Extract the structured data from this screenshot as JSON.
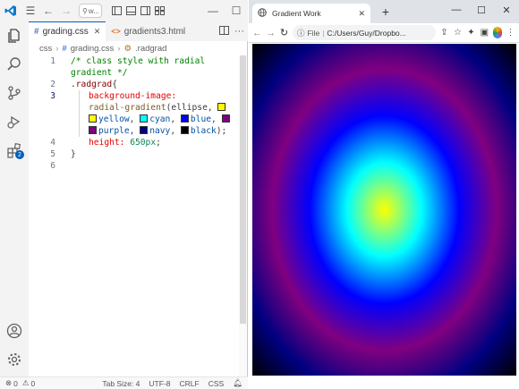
{
  "vscode": {
    "search_text": "w...",
    "tabs": [
      {
        "name": "grading.css",
        "active": true
      },
      {
        "name": "gradients3.html",
        "active": false
      }
    ],
    "breadcrumb": {
      "folder": "css",
      "file": "grading.css",
      "symbol": ".radgrad"
    },
    "line_numbers": [
      "1",
      "",
      "2",
      "3",
      "",
      "",
      "",
      "4",
      "5",
      "6"
    ],
    "code": {
      "line1a": "/* class style with radial",
      "line1b": "gradient */",
      "line2_selector": ".radgrad",
      "line2_brace": "{",
      "line3_prop": "background-image:",
      "line3_fn": "radial-gradient",
      "line3_args": "(ellipse, ",
      "line3_yellow": "yellow",
      "line3_cyan": "cyan",
      "line3_blue": "blue",
      "line3_purple": "purple",
      "line3_navy": "navy",
      "line3_black": "black",
      "line3_end": ");",
      "line4_prop": "height:",
      "line4_value": "650px",
      "line4_end": ";",
      "line5": "}",
      "comma": ", "
    },
    "swatch_colors": {
      "yellow": "#ffff00",
      "cyan": "#00ffff",
      "blue": "#0000ff",
      "purple": "#800080",
      "navy": "#000080",
      "black": "#000000"
    },
    "accounts_badge": "2",
    "status": {
      "errors": "0",
      "warnings": "0",
      "tab_size": "Tab Size: 4",
      "encoding": "UTF-8",
      "eol": "CRLF",
      "language": "CSS"
    },
    "accent": "#005fb8"
  },
  "browser": {
    "tab_title": "Gradient Work",
    "omnibox_label": "File",
    "omnibox_url": "C:/Users/Guy/Dropbo..."
  },
  "gradient": {
    "shape": "ellipse",
    "colors": [
      "yellow",
      "cyan",
      "blue",
      "purple",
      "navy",
      "black"
    ]
  }
}
